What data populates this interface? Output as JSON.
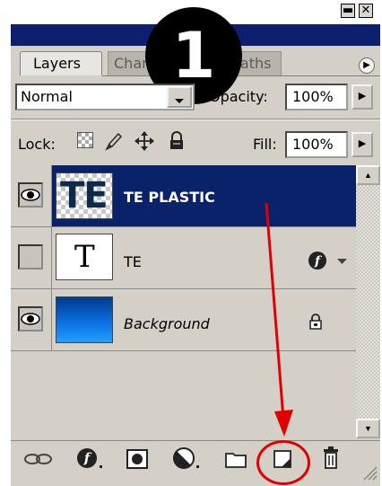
{
  "step_number": "1",
  "tabs": [
    {
      "label": "Layers",
      "active": true
    },
    {
      "label": "Channels",
      "active": false
    },
    {
      "label": "Paths",
      "active": false
    }
  ],
  "blend_mode": "Normal",
  "opacity": {
    "label": "Opacity:",
    "value": "100%"
  },
  "lock": {
    "label": "Lock:"
  },
  "fill": {
    "label": "Fill:",
    "value": "100%"
  },
  "layers": [
    {
      "name": "TE PLASTIC",
      "thumb_text": "TE",
      "visible": true,
      "selected": true
    },
    {
      "name": "TE",
      "thumb_text": "T",
      "visible": false,
      "selected": false
    },
    {
      "name": "Background",
      "visible": true,
      "selected": false,
      "locked": true
    }
  ],
  "colors": {
    "selected_row": "#0a2269",
    "panel": "#d4d0c8",
    "annotation": "#e00000"
  },
  "toolbar_icons": [
    "link-icon",
    "layer-style-icon",
    "mask-icon",
    "adjustment-icon",
    "folder-icon",
    "new-layer-icon",
    "trash-icon"
  ]
}
